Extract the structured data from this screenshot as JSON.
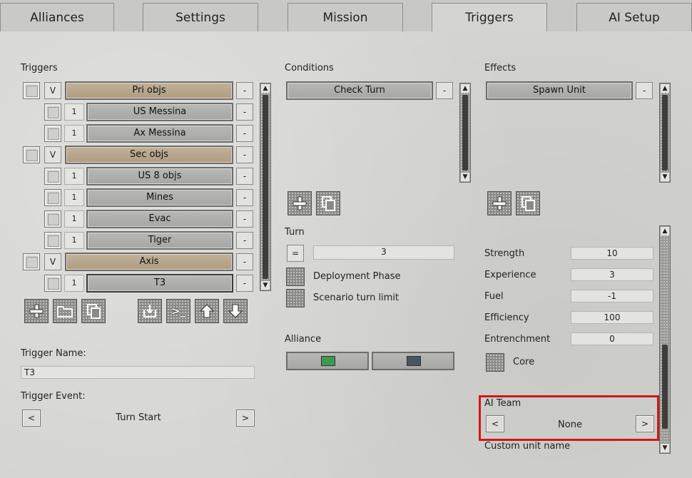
{
  "tabs": [
    "Alliances",
    "Settings",
    "Mission",
    "Triggers",
    "AI Setup"
  ],
  "active_tab": "Triggers",
  "triggers": {
    "header": "Triggers",
    "rows": [
      {
        "kind": "group",
        "toggle": "V",
        "label": "Pri objs",
        "remove": "-"
      },
      {
        "kind": "item",
        "count": "1",
        "label": "US Messina",
        "remove": "-"
      },
      {
        "kind": "item",
        "count": "1",
        "label": "Ax Messina",
        "remove": "-"
      },
      {
        "kind": "group",
        "toggle": "V",
        "label": "Sec objs",
        "remove": "-"
      },
      {
        "kind": "item",
        "count": "1",
        "label": "US 8 objs",
        "remove": "-"
      },
      {
        "kind": "item",
        "count": "1",
        "label": "Mines",
        "remove": "-"
      },
      {
        "kind": "item",
        "count": "1",
        "label": "Evac",
        "remove": "-"
      },
      {
        "kind": "item",
        "count": "1",
        "label": "Tiger",
        "remove": "-"
      },
      {
        "kind": "group",
        "toggle": "V",
        "label": "Axis",
        "remove": "-"
      },
      {
        "kind": "item",
        "count": "1",
        "label": "T3",
        "remove": "-"
      }
    ],
    "tool_icons": [
      "plus-icon",
      "folder-icon",
      "copy-icon",
      "import-icon",
      "console-icon",
      "arrow-up-icon",
      "arrow-down-icon"
    ],
    "console_glyph": ">_"
  },
  "trigger_name": {
    "label": "Trigger Name:",
    "value": "T3"
  },
  "trigger_event": {
    "label": "Trigger Event:",
    "value": "Turn Start",
    "prev": "<",
    "next": ">"
  },
  "conditions": {
    "header": "Conditions",
    "items": [
      {
        "label": "Check Turn",
        "remove": "-"
      }
    ]
  },
  "turn": {
    "header": "Turn",
    "operator": "=",
    "value": "3",
    "deployment_phase": "Deployment Phase",
    "scenario_turn_limit": "Scenario turn limit"
  },
  "alliance": {
    "header": "Alliance",
    "colors": [
      "#3e9a53",
      "#4a5563"
    ]
  },
  "effects": {
    "header": "Effects",
    "items": [
      {
        "label": "Spawn Unit",
        "remove": "-"
      }
    ]
  },
  "unit": {
    "strength": {
      "label": "Strength",
      "value": "10"
    },
    "experience": {
      "label": "Experience",
      "value": "3"
    },
    "fuel": {
      "label": "Fuel",
      "value": "-1"
    },
    "efficiency": {
      "label": "Efficiency",
      "value": "100"
    },
    "entrenchment": {
      "label": "Entrenchment",
      "value": "0"
    },
    "core": "Core",
    "ai_team": {
      "label": "AI Team",
      "value": "None",
      "prev": "<",
      "next": ">"
    },
    "custom_name": {
      "label": "Custom unit name"
    }
  },
  "scroll_arrows": {
    "up": "▲",
    "down": "▼"
  },
  "colors": {
    "highlight": "#d0161c",
    "group_bar": "#b8a68a",
    "item_bar": "#acaca8"
  }
}
